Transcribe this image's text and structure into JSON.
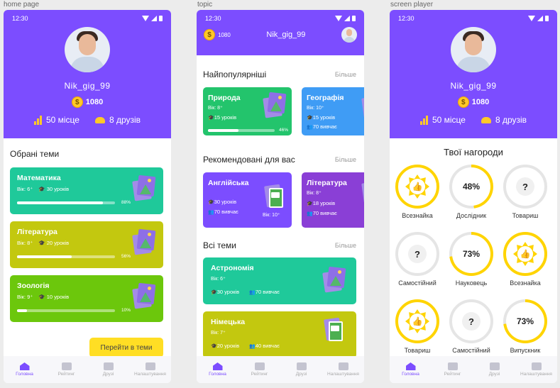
{
  "frames": {
    "home": "home page",
    "topic": "topic",
    "player": "screen player"
  },
  "status_time": "12:30",
  "user": {
    "name": "Nik_gig_99",
    "coins": "1080",
    "place": "50 місце",
    "friends": "8 друзів"
  },
  "home": {
    "section_title": "Обрані теми",
    "cards": [
      {
        "title": "Математика",
        "age": "Вік: 6⁺",
        "lessons": "30 уроків",
        "progress": 88,
        "pct": "88%",
        "color": "#1fc99a"
      },
      {
        "title": "Література",
        "age": "Вік: 8⁺",
        "lessons": "20 уроків",
        "progress": 56,
        "pct": "56%",
        "color": "#c3c80f"
      },
      {
        "title": "Зоологія",
        "age": "Вік: 9⁺",
        "lessons": "10 уроків",
        "progress": 10,
        "pct": "10%",
        "color": "#6cc70c"
      }
    ],
    "go_button": "Перейти в теми"
  },
  "topic": {
    "popular": {
      "title": "Найпопулярніші",
      "more": "Більше",
      "cards": [
        {
          "title": "Природа",
          "age": "Вік: 8⁺",
          "lessons": "15 уроків",
          "progress": 46,
          "pct": "46%",
          "color": "#23c46c"
        },
        {
          "title": "Географія",
          "age": "Вік: 10⁺",
          "lessons": "15 уроків",
          "learning": "70 вивчає",
          "color": "#3f9cf5"
        }
      ]
    },
    "recommended": {
      "title": "Рекомендовані для вас",
      "more": "Більше",
      "cards": [
        {
          "title": "Англійська",
          "lessons": "30 уроків",
          "learning": "70 вивчає",
          "age": "Вік: 10⁺",
          "color": "#7c4dff"
        },
        {
          "title": "Література",
          "age": "Вік: 8⁺",
          "lessons": "18 уроків",
          "learning": "70 вивчає",
          "color": "#8a3fd6"
        }
      ]
    },
    "all": {
      "title": "Всі теми",
      "more": "Більше",
      "cards": [
        {
          "title": "Астрономія",
          "age": "Вік: 6⁺",
          "lessons": "30 уроків",
          "learning": "70 вивчає",
          "color": "#1fc99a"
        },
        {
          "title": "Німецька",
          "age": "Вік: 7⁺",
          "lessons": "20 уроків",
          "learning": "40 вивчає",
          "color": "#c3c80f"
        }
      ]
    }
  },
  "player": {
    "rewards_title": "Твої нагороди",
    "rewards": [
      {
        "label": "Всезнайка",
        "kind": "badge",
        "value": "",
        "progress": 100
      },
      {
        "label": "Дослідник",
        "kind": "percent",
        "value": "48%",
        "progress": 48
      },
      {
        "label": "Товариш",
        "kind": "locked",
        "value": "?",
        "progress": 0
      },
      {
        "label": "Самостійний",
        "kind": "locked",
        "value": "?",
        "progress": 0
      },
      {
        "label": "Науковець",
        "kind": "percent",
        "value": "73%",
        "progress": 73
      },
      {
        "label": "Всезнайка",
        "kind": "badge",
        "value": "",
        "progress": 100
      },
      {
        "label": "Товариш",
        "kind": "badge",
        "value": "",
        "progress": 100
      },
      {
        "label": "Самостійний",
        "kind": "locked",
        "value": "?",
        "progress": 0
      },
      {
        "label": "Випускник",
        "kind": "percent",
        "value": "73%",
        "progress": 73
      }
    ]
  },
  "nav": [
    "Головна",
    "Рейтинг",
    "Друзі",
    "Налаштування"
  ],
  "colors": {
    "brand": "#7c4dff",
    "gold": "#ffd400"
  }
}
